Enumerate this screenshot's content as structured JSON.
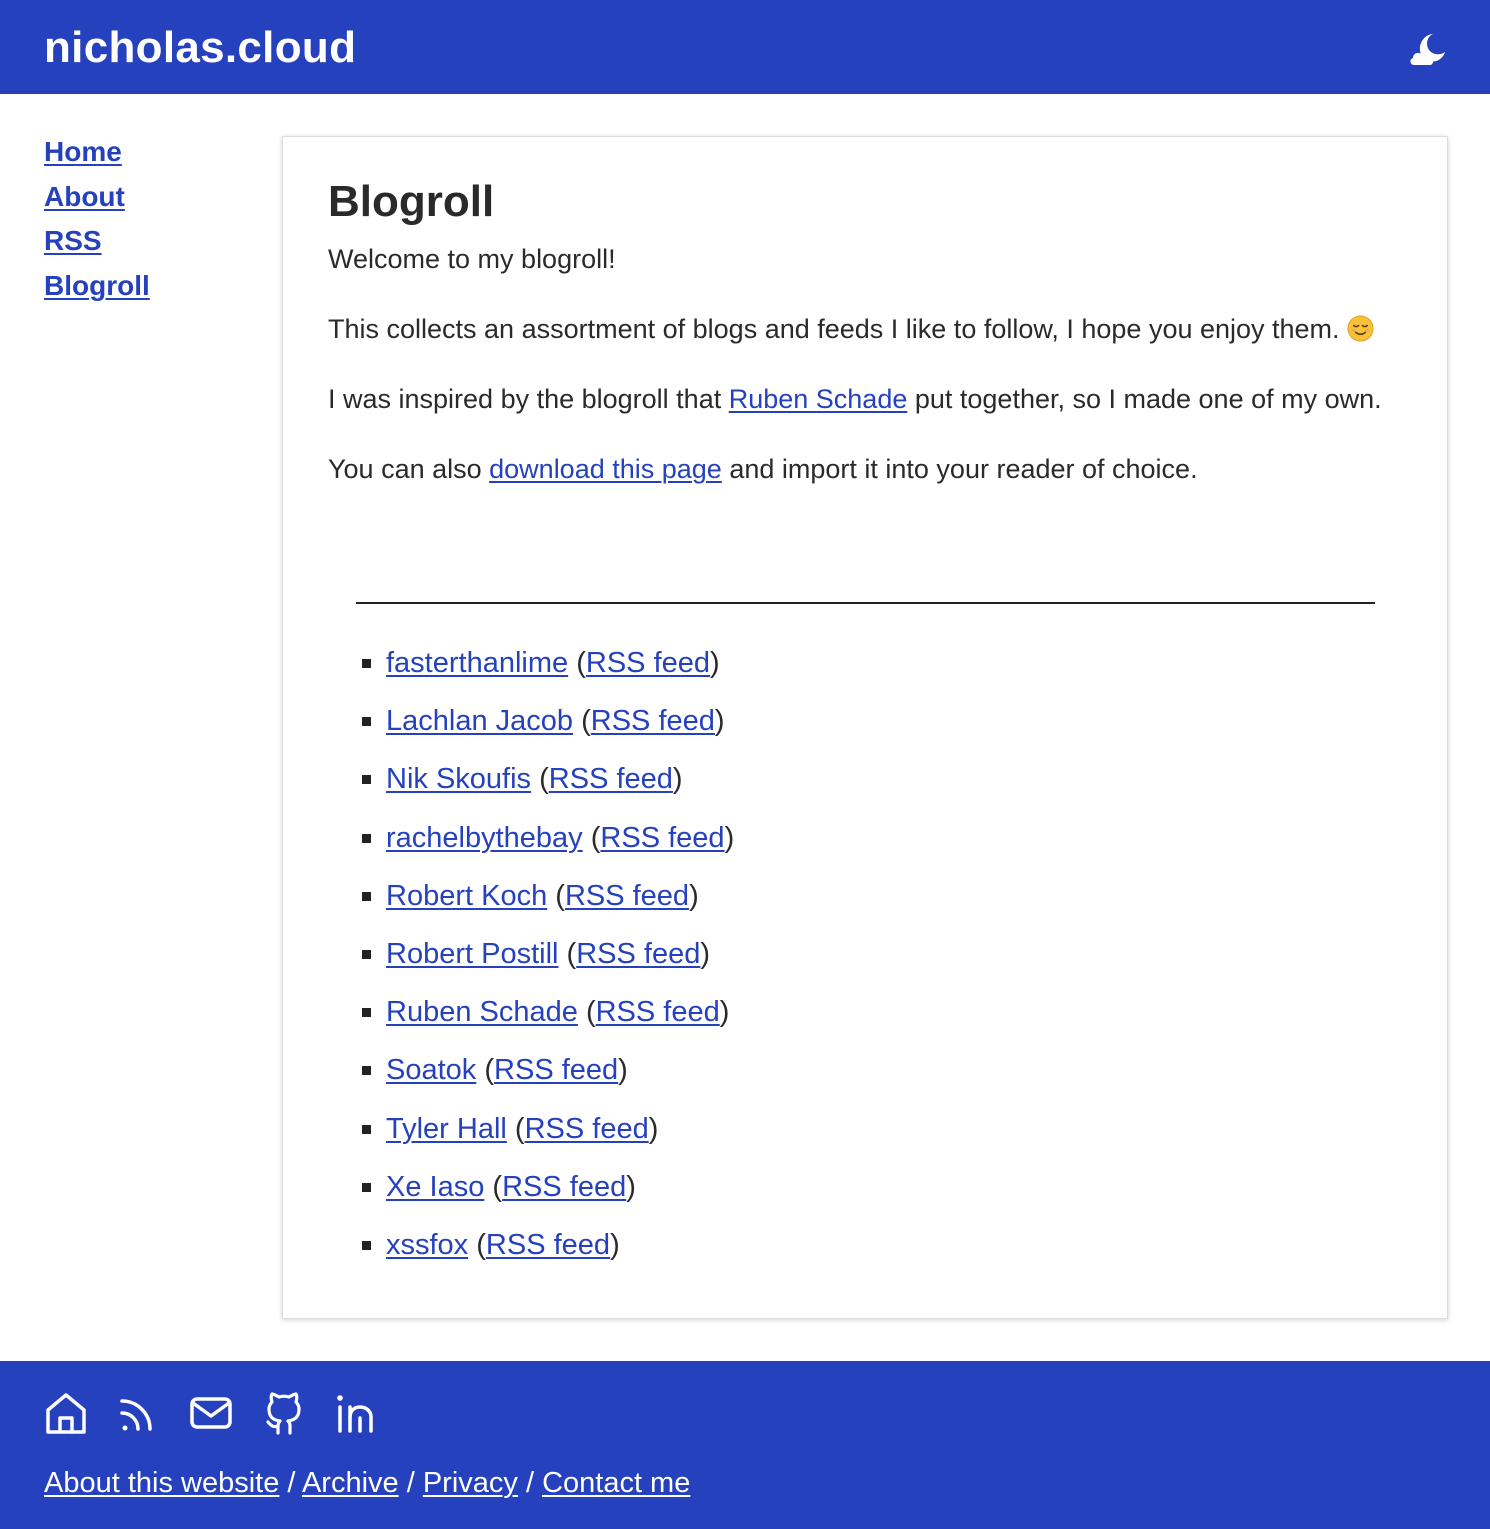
{
  "header": {
    "site_title": "nicholas.cloud",
    "theme_icon": "moon-cloud-icon"
  },
  "sidebar": {
    "items": [
      {
        "label": "Home"
      },
      {
        "label": "About"
      },
      {
        "label": "RSS"
      },
      {
        "label": "Blogroll"
      }
    ]
  },
  "main": {
    "title": "Blogroll",
    "welcome": "Welcome to my blogroll!",
    "p1_text": "This collects an assortment of blogs and feeds I like to follow, I hope you enjoy them.",
    "p1_emoji": "smiling-face-icon",
    "p2_before": "I was inspired by the blogroll that ",
    "p2_link": "Ruben Schade",
    "p2_after": " put together, so I made one of my own.",
    "p3_before": "You can also ",
    "p3_link": "download this page",
    "p3_after": " and import it into your reader of choice.",
    "feed_label": "RSS feed",
    "open_paren": "(",
    "close_paren": ")",
    "feeds": [
      {
        "name": "fasterthanlime"
      },
      {
        "name": "Lachlan Jacob"
      },
      {
        "name": "Nik Skoufis"
      },
      {
        "name": "rachelbythebay"
      },
      {
        "name": "Robert Koch"
      },
      {
        "name": "Robert Postill"
      },
      {
        "name": "Ruben Schade"
      },
      {
        "name": "Soatok"
      },
      {
        "name": "Tyler Hall"
      },
      {
        "name": "Xe Iaso"
      },
      {
        "name": "xssfox"
      }
    ]
  },
  "footer": {
    "icons": [
      "home-icon",
      "rss-icon",
      "mail-icon",
      "github-icon",
      "linkedin-icon"
    ],
    "links": [
      {
        "label": "About this website"
      },
      {
        "label": "Archive"
      },
      {
        "label": "Privacy"
      },
      {
        "label": "Contact me"
      }
    ],
    "separator": " / "
  },
  "colors": {
    "brand": "#2541bd",
    "text": "#2a2a2a",
    "background": "#ffffff"
  }
}
